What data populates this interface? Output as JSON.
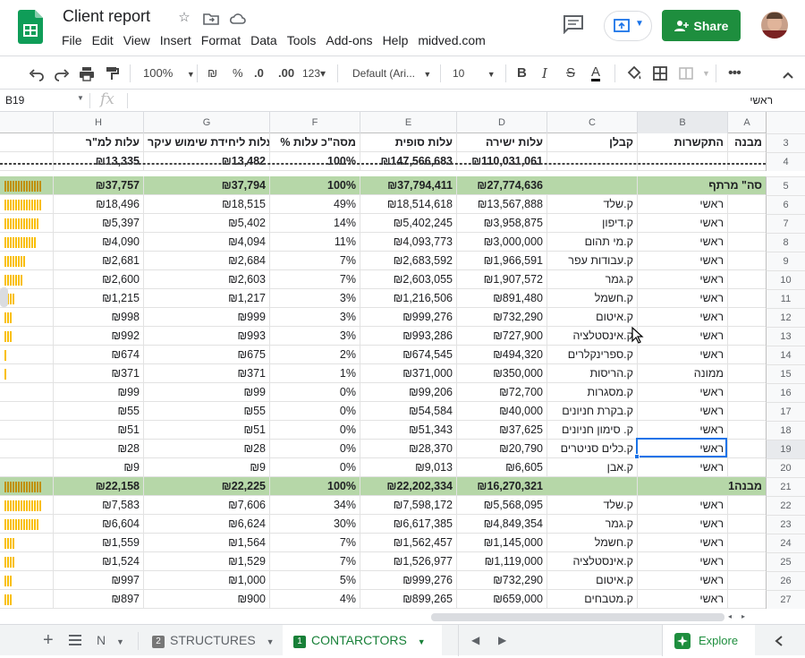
{
  "app": {
    "title": "Client report",
    "menu": [
      "File",
      "Edit",
      "View",
      "Insert",
      "Format",
      "Data",
      "Tools",
      "Add-ons",
      "Help",
      "midved.com"
    ],
    "share_label": "Share"
  },
  "toolbar": {
    "zoom": "100%",
    "currency": "₪",
    "percent": "%",
    "dec_less": ".0",
    "dec_more": ".00",
    "format_more": "123▾",
    "font": "Default (Ari...",
    "font_size": "10",
    "bold": "B",
    "italic": "I",
    "strike": "S",
    "text_color": "A"
  },
  "formula_bar": {
    "name_box": "B19",
    "fx": "fx",
    "value": "ראשי"
  },
  "columns": [
    "A",
    "B",
    "C",
    "D",
    "E",
    "F",
    "G",
    "H"
  ],
  "rows": [
    {
      "n": "3",
      "type": "hdr",
      "a": "מבנה",
      "b": "התקשרות",
      "c": "קבלן",
      "d": "עלות ישירה",
      "e": "עלות סופית",
      "f": "% מסה\"כ עלות",
      "g": "עלות ליחידת שימוש עיקר",
      "h": "עלות למ\"ר",
      "spark": 0
    },
    {
      "n": "4",
      "type": "total",
      "a": "",
      "b": "",
      "c": "",
      "d": "₪110,031,061",
      "e": "₪147,566,683",
      "f": "100%",
      "g": "₪13,482",
      "h": "₪13,335",
      "spark": 0
    },
    {
      "n": "5",
      "type": "sum",
      "a": "סה\" מרתף",
      "b": "",
      "c": "",
      "d": "₪27,774,636",
      "e": "₪37,794,411",
      "f": "100%",
      "g": "₪37,794",
      "h": "₪37,757",
      "spark": 14
    },
    {
      "n": "6",
      "type": "row",
      "a": "",
      "b": "ראשי",
      "c": "ק.שלד",
      "d": "₪13,567,888",
      "e": "₪18,514,618",
      "f": "49%",
      "g": "₪18,515",
      "h": "₪18,496",
      "spark": 14
    },
    {
      "n": "7",
      "type": "row",
      "a": "",
      "b": "ראשי",
      "c": "ק.דיפון",
      "d": "₪3,958,875",
      "e": "₪5,402,245",
      "f": "14%",
      "g": "₪5,402",
      "h": "₪5,397",
      "spark": 13
    },
    {
      "n": "8",
      "type": "row",
      "a": "",
      "b": "ראשי",
      "c": "ק.מי תהום",
      "d": "₪3,000,000",
      "e": "₪4,093,773",
      "f": "11%",
      "g": "₪4,094",
      "h": "₪4,090",
      "spark": 12
    },
    {
      "n": "9",
      "type": "row",
      "a": "",
      "b": "ראשי",
      "c": "ק.עבודות עפר",
      "d": "₪1,966,591",
      "e": "₪2,683,592",
      "f": "7%",
      "g": "₪2,684",
      "h": "₪2,681",
      "spark": 8
    },
    {
      "n": "10",
      "type": "row",
      "a": "",
      "b": "ראשי",
      "c": "ק.גמר",
      "d": "₪1,907,572",
      "e": "₪2,603,055",
      "f": "7%",
      "g": "₪2,603",
      "h": "₪2,600",
      "spark": 7
    },
    {
      "n": "11",
      "type": "row",
      "a": "",
      "b": "ראשי",
      "c": "ק.חשמל",
      "d": "₪891,480",
      "e": "₪1,216,506",
      "f": "3%",
      "g": "₪1,217",
      "h": "₪1,215",
      "spark": 4
    },
    {
      "n": "12",
      "type": "row",
      "a": "",
      "b": "ראשי",
      "c": "ק.איטום",
      "d": "₪732,290",
      "e": "₪999,276",
      "f": "3%",
      "g": "₪999",
      "h": "₪998",
      "spark": 3
    },
    {
      "n": "13",
      "type": "row",
      "a": "",
      "b": "ראשי",
      "c": "ק.אינסטלציה",
      "d": "₪727,900",
      "e": "₪993,286",
      "f": "3%",
      "g": "₪993",
      "h": "₪992",
      "spark": 3
    },
    {
      "n": "14",
      "type": "row",
      "a": "",
      "b": "ראשי",
      "c": "ק.ספרינקלרים",
      "d": "₪494,320",
      "e": "₪674,545",
      "f": "2%",
      "g": "₪675",
      "h": "₪674",
      "spark": 1
    },
    {
      "n": "15",
      "type": "row",
      "a": "",
      "b": "ממונה",
      "c": "ק.הריסות",
      "d": "₪350,000",
      "e": "₪371,000",
      "f": "1%",
      "g": "₪371",
      "h": "₪371",
      "spark": 1
    },
    {
      "n": "16",
      "type": "row",
      "a": "",
      "b": "ראשי",
      "c": "ק.מסגרות",
      "d": "₪72,700",
      "e": "₪99,206",
      "f": "0%",
      "g": "₪99",
      "h": "₪99",
      "spark": 0
    },
    {
      "n": "17",
      "type": "row",
      "a": "",
      "b": "ראשי",
      "c": "ק.בקרת חניונים",
      "d": "₪40,000",
      "e": "₪54,584",
      "f": "0%",
      "g": "₪55",
      "h": "₪55",
      "spark": 0
    },
    {
      "n": "18",
      "type": "row",
      "a": "",
      "b": "ראשי",
      "c": "ק. סימון חניונים",
      "d": "₪37,625",
      "e": "₪51,343",
      "f": "0%",
      "g": "₪51",
      "h": "₪51",
      "spark": 0
    },
    {
      "n": "19",
      "type": "row",
      "a": "",
      "b": "ראשי",
      "c": "ק.כלים סניטרים",
      "d": "₪20,790",
      "e": "₪28,370",
      "f": "0%",
      "g": "₪28",
      "h": "₪28",
      "spark": 0
    },
    {
      "n": "20",
      "type": "row",
      "a": "",
      "b": "ראשי",
      "c": "ק.אבן",
      "d": "₪6,605",
      "e": "₪9,013",
      "f": "0%",
      "g": "₪9",
      "h": "₪9",
      "spark": 0
    },
    {
      "n": "21",
      "type": "sum",
      "a": "מבנה1",
      "b": "",
      "c": "",
      "d": "₪16,270,321",
      "e": "₪22,202,334",
      "f": "100%",
      "g": "₪22,225",
      "h": "₪22,158",
      "spark": 14
    },
    {
      "n": "22",
      "type": "row",
      "a": "",
      "b": "ראשי",
      "c": "ק.שלד",
      "d": "₪5,568,095",
      "e": "₪7,598,172",
      "f": "34%",
      "g": "₪7,606",
      "h": "₪7,583",
      "spark": 14
    },
    {
      "n": "23",
      "type": "row",
      "a": "",
      "b": "ראשי",
      "c": "ק.גמר",
      "d": "₪4,849,354",
      "e": "₪6,617,385",
      "f": "30%",
      "g": "₪6,624",
      "h": "₪6,604",
      "spark": 13
    },
    {
      "n": "24",
      "type": "row",
      "a": "",
      "b": "ראשי",
      "c": "ק.חשמל",
      "d": "₪1,145,000",
      "e": "₪1,562,457",
      "f": "7%",
      "g": "₪1,564",
      "h": "₪1,559",
      "spark": 4
    },
    {
      "n": "25",
      "type": "row",
      "a": "",
      "b": "ראשי",
      "c": "ק.אינסטלציה",
      "d": "₪1,119,000",
      "e": "₪1,526,977",
      "f": "7%",
      "g": "₪1,529",
      "h": "₪1,524",
      "spark": 4
    },
    {
      "n": "26",
      "type": "row",
      "a": "",
      "b": "ראשי",
      "c": "ק.איטום",
      "d": "₪732,290",
      "e": "₪999,276",
      "f": "5%",
      "g": "₪1,000",
      "h": "₪997",
      "spark": 3
    },
    {
      "n": "27",
      "type": "row",
      "a": "",
      "b": "ראשי",
      "c": "ק.מטבחים",
      "d": "₪659,000",
      "e": "₪899,265",
      "f": "4%",
      "g": "₪900",
      "h": "₪897",
      "spark": 3
    }
  ],
  "tabs": {
    "partial": "N",
    "t2_num": "2",
    "t2": "STRUCTURES",
    "t1_num": "1",
    "t1": "CONTARCTORS",
    "explore": "Explore"
  },
  "colors": {
    "green": "#1e8e3e",
    "sum_fill": "#b6d7a8",
    "spark": "#f9bf00",
    "selection": "#1a73e8"
  }
}
